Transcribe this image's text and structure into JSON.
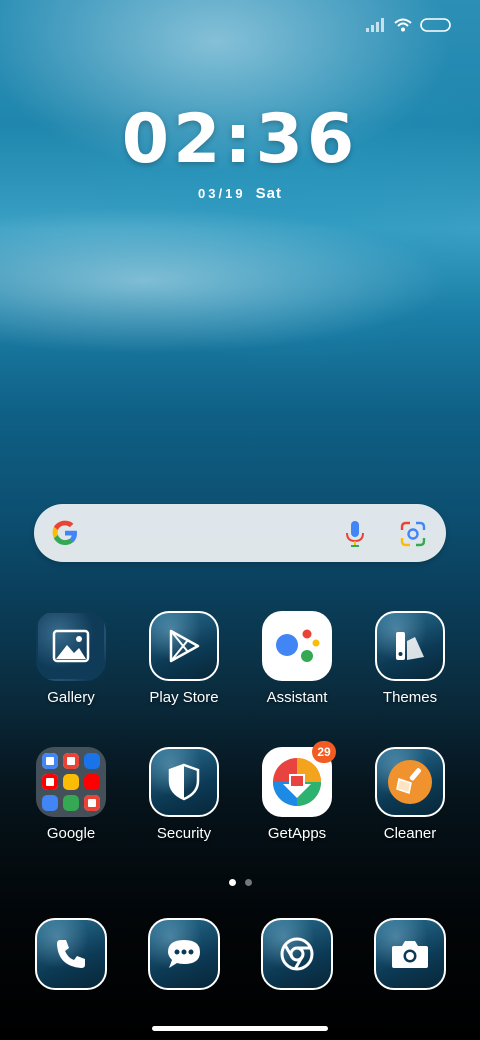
{
  "status_bar": {
    "icons": [
      "signal-icon",
      "wifi-icon",
      "battery-icon"
    ]
  },
  "clock": {
    "time": "02:36",
    "date": "03/19",
    "day": "Sat"
  },
  "search": {
    "icons": [
      "google-g-icon",
      "mic-icon",
      "lens-icon"
    ]
  },
  "apps": [
    {
      "label": "Gallery",
      "icon": "gallery-icon"
    },
    {
      "label": "Play Store",
      "icon": "play-store-icon"
    },
    {
      "label": "Assistant",
      "icon": "assistant-icon"
    },
    {
      "label": "Themes",
      "icon": "themes-icon"
    },
    {
      "label": "Google",
      "icon": "folder-icon"
    },
    {
      "label": "Security",
      "icon": "shield-icon"
    },
    {
      "label": "GetApps",
      "icon": "getapps-icon",
      "badge": "29"
    },
    {
      "label": "Cleaner",
      "icon": "broom-icon"
    }
  ],
  "page_indicator": {
    "pages": 2,
    "current": 1
  },
  "dock": [
    {
      "icon": "phone-icon"
    },
    {
      "icon": "messages-icon"
    },
    {
      "icon": "chrome-icon"
    },
    {
      "icon": "camera-icon"
    }
  ],
  "colors": {
    "badge": "#f25b22",
    "search_bg": "#f0f2f4"
  }
}
